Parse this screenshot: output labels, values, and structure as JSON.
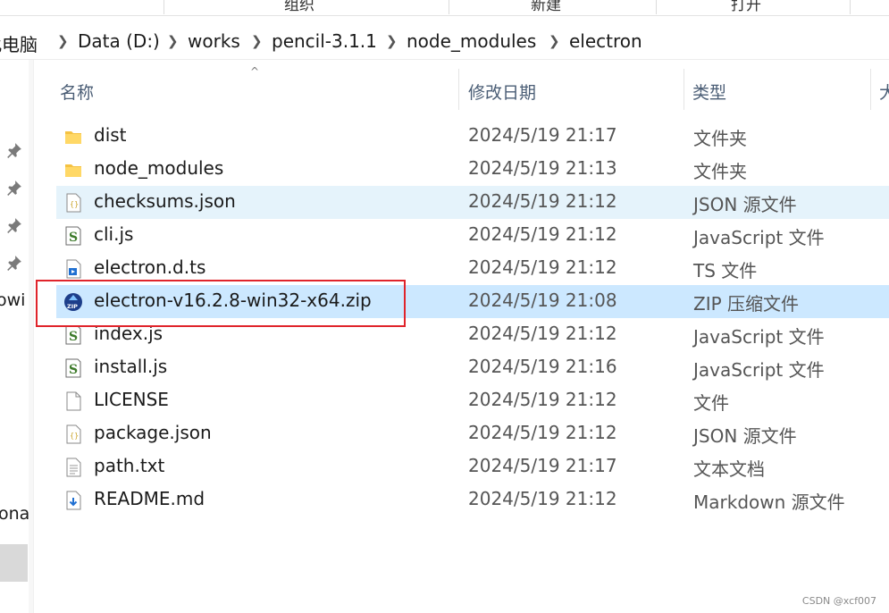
{
  "ribbon": {
    "groups": [
      "组织",
      "新建",
      "打开"
    ]
  },
  "breadcrumb": [
    "此电脑",
    "Data (D:)",
    "works",
    "pencil-3.1.1",
    "node_modules",
    "electron"
  ],
  "nav": {
    "partial_labels": [
      "owi",
      "ona"
    ]
  },
  "columns": [
    "名称",
    "修改日期",
    "类型",
    "大"
  ],
  "rows": [
    {
      "name": "dist",
      "date": "2024/5/19 21:17",
      "type": "文件夹",
      "icon": "folder-icon",
      "state": ""
    },
    {
      "name": "node_modules",
      "date": "2024/5/19 21:13",
      "type": "文件夹",
      "icon": "folder-icon",
      "state": ""
    },
    {
      "name": "checksums.json",
      "date": "2024/5/19 21:12",
      "type": "JSON 源文件",
      "icon": "json-file-icon",
      "state": "hover"
    },
    {
      "name": "cli.js",
      "date": "2024/5/19 21:12",
      "type": "JavaScript 文件",
      "icon": "js-file-icon",
      "state": ""
    },
    {
      "name": "electron.d.ts",
      "date": "2024/5/19 21:12",
      "type": "TS 文件",
      "icon": "ts-file-icon",
      "state": ""
    },
    {
      "name": "electron-v16.2.8-win32-x64.zip",
      "date": "2024/5/19 21:08",
      "type": "ZIP 压缩文件",
      "icon": "zip-file-icon",
      "state": "sel"
    },
    {
      "name": "index.js",
      "date": "2024/5/19 21:12",
      "type": "JavaScript 文件",
      "icon": "js-file-icon",
      "state": ""
    },
    {
      "name": "install.js",
      "date": "2024/5/19 21:16",
      "type": "JavaScript 文件",
      "icon": "js-file-icon",
      "state": ""
    },
    {
      "name": "LICENSE",
      "date": "2024/5/19 21:12",
      "type": "文件",
      "icon": "blank-file-icon",
      "state": ""
    },
    {
      "name": "package.json",
      "date": "2024/5/19 21:12",
      "type": "JSON 源文件",
      "icon": "json-file-icon",
      "state": ""
    },
    {
      "name": "path.txt",
      "date": "2024/5/19 21:17",
      "type": "文本文档",
      "icon": "text-file-icon",
      "state": ""
    },
    {
      "name": "README.md",
      "date": "2024/5/19 21:12",
      "type": "Markdown 源文件",
      "icon": "markdown-file-icon",
      "state": ""
    }
  ],
  "watermark": "CSDN @xcf007",
  "colors": {
    "hover": "#e5f3fb",
    "selected": "#cce8ff",
    "highlight_box": "#e0242b",
    "header_text": "#4a5d75"
  }
}
